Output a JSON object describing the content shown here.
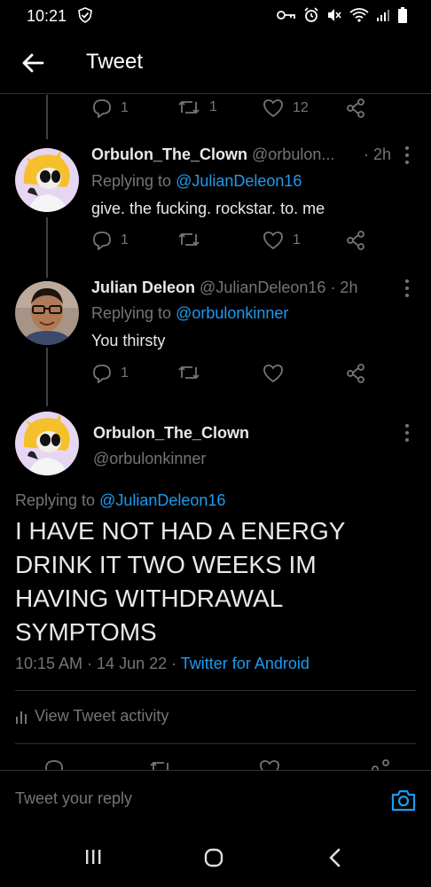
{
  "status_bar": {
    "time": "10:21",
    "icons": [
      "check-shield-icon",
      "key-icon",
      "alarm-icon",
      "mute-icon",
      "wifi-icon",
      "signal-icon",
      "battery-icon"
    ]
  },
  "header": {
    "title": "Tweet",
    "back_icon": "arrow-left-icon"
  },
  "top_tweet_actions": {
    "replies": "1",
    "retweets": "1",
    "likes": "12"
  },
  "reply_tweet_1": {
    "name": "Orbulon_The_Clown",
    "handle": "@orbulon...",
    "time": "· 2h",
    "replying_prefix": "Replying to ",
    "replying_to": "@JulianDeleon16",
    "text": "give. the fucking. rockstar. to. me",
    "replies": "1",
    "retweets": "",
    "likes": "1"
  },
  "reply_tweet_2": {
    "name": "Julian Deleon",
    "handle": "@JulianDeleon16",
    "time": "· 2h",
    "replying_prefix": "Replying to ",
    "replying_to": "@orbulonkinner",
    "text": "You thirsty",
    "replies": "1",
    "retweets": "",
    "likes": ""
  },
  "main_tweet": {
    "name": "Orbulon_The_Clown",
    "handle": "@orbulonkinner",
    "replying_prefix": "Replying to ",
    "replying_to": "@JulianDeleon16",
    "text_lines": [
      "I HAVE NOT HAD A ENERGY",
      "DRINK IT TWO WEEKS IM",
      "HAVING WITHDRAWAL",
      "SYMPTOMS"
    ],
    "timestamp": "10:15 AM · 14 Jun 22 · ",
    "source": "Twitter for Android",
    "activity_label": "View Tweet activity"
  },
  "reply_bar": {
    "placeholder": "Tweet your reply"
  },
  "colors": {
    "background": "#000000",
    "text": "#e7e9ea",
    "muted": "#71767b",
    "link": "#1d9bf0",
    "divider": "#2f3336"
  }
}
